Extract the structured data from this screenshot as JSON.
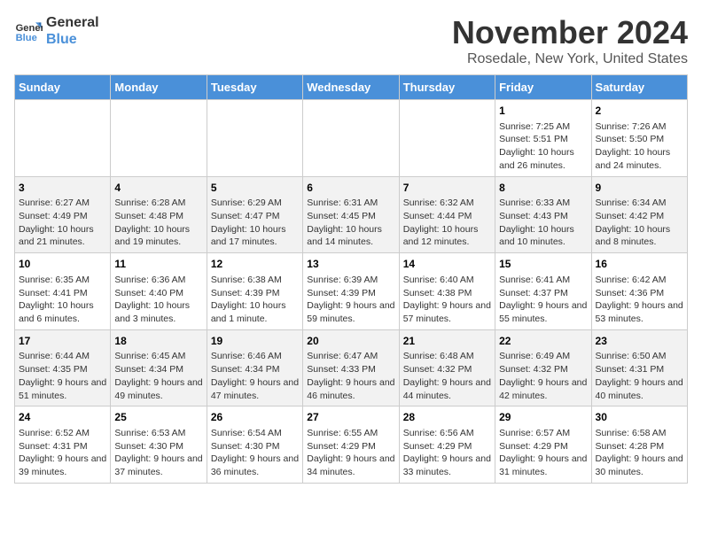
{
  "header": {
    "logo_general": "General",
    "logo_blue": "Blue",
    "month": "November 2024",
    "location": "Rosedale, New York, United States"
  },
  "weekdays": [
    "Sunday",
    "Monday",
    "Tuesday",
    "Wednesday",
    "Thursday",
    "Friday",
    "Saturday"
  ],
  "weeks": [
    [
      {
        "day": "",
        "info": ""
      },
      {
        "day": "",
        "info": ""
      },
      {
        "day": "",
        "info": ""
      },
      {
        "day": "",
        "info": ""
      },
      {
        "day": "",
        "info": ""
      },
      {
        "day": "1",
        "info": "Sunrise: 7:25 AM\nSunset: 5:51 PM\nDaylight: 10 hours and 26 minutes."
      },
      {
        "day": "2",
        "info": "Sunrise: 7:26 AM\nSunset: 5:50 PM\nDaylight: 10 hours and 24 minutes."
      }
    ],
    [
      {
        "day": "3",
        "info": "Sunrise: 6:27 AM\nSunset: 4:49 PM\nDaylight: 10 hours and 21 minutes."
      },
      {
        "day": "4",
        "info": "Sunrise: 6:28 AM\nSunset: 4:48 PM\nDaylight: 10 hours and 19 minutes."
      },
      {
        "day": "5",
        "info": "Sunrise: 6:29 AM\nSunset: 4:47 PM\nDaylight: 10 hours and 17 minutes."
      },
      {
        "day": "6",
        "info": "Sunrise: 6:31 AM\nSunset: 4:45 PM\nDaylight: 10 hours and 14 minutes."
      },
      {
        "day": "7",
        "info": "Sunrise: 6:32 AM\nSunset: 4:44 PM\nDaylight: 10 hours and 12 minutes."
      },
      {
        "day": "8",
        "info": "Sunrise: 6:33 AM\nSunset: 4:43 PM\nDaylight: 10 hours and 10 minutes."
      },
      {
        "day": "9",
        "info": "Sunrise: 6:34 AM\nSunset: 4:42 PM\nDaylight: 10 hours and 8 minutes."
      }
    ],
    [
      {
        "day": "10",
        "info": "Sunrise: 6:35 AM\nSunset: 4:41 PM\nDaylight: 10 hours and 6 minutes."
      },
      {
        "day": "11",
        "info": "Sunrise: 6:36 AM\nSunset: 4:40 PM\nDaylight: 10 hours and 3 minutes."
      },
      {
        "day": "12",
        "info": "Sunrise: 6:38 AM\nSunset: 4:39 PM\nDaylight: 10 hours and 1 minute."
      },
      {
        "day": "13",
        "info": "Sunrise: 6:39 AM\nSunset: 4:39 PM\nDaylight: 9 hours and 59 minutes."
      },
      {
        "day": "14",
        "info": "Sunrise: 6:40 AM\nSunset: 4:38 PM\nDaylight: 9 hours and 57 minutes."
      },
      {
        "day": "15",
        "info": "Sunrise: 6:41 AM\nSunset: 4:37 PM\nDaylight: 9 hours and 55 minutes."
      },
      {
        "day": "16",
        "info": "Sunrise: 6:42 AM\nSunset: 4:36 PM\nDaylight: 9 hours and 53 minutes."
      }
    ],
    [
      {
        "day": "17",
        "info": "Sunrise: 6:44 AM\nSunset: 4:35 PM\nDaylight: 9 hours and 51 minutes."
      },
      {
        "day": "18",
        "info": "Sunrise: 6:45 AM\nSunset: 4:34 PM\nDaylight: 9 hours and 49 minutes."
      },
      {
        "day": "19",
        "info": "Sunrise: 6:46 AM\nSunset: 4:34 PM\nDaylight: 9 hours and 47 minutes."
      },
      {
        "day": "20",
        "info": "Sunrise: 6:47 AM\nSunset: 4:33 PM\nDaylight: 9 hours and 46 minutes."
      },
      {
        "day": "21",
        "info": "Sunrise: 6:48 AM\nSunset: 4:32 PM\nDaylight: 9 hours and 44 minutes."
      },
      {
        "day": "22",
        "info": "Sunrise: 6:49 AM\nSunset: 4:32 PM\nDaylight: 9 hours and 42 minutes."
      },
      {
        "day": "23",
        "info": "Sunrise: 6:50 AM\nSunset: 4:31 PM\nDaylight: 9 hours and 40 minutes."
      }
    ],
    [
      {
        "day": "24",
        "info": "Sunrise: 6:52 AM\nSunset: 4:31 PM\nDaylight: 9 hours and 39 minutes."
      },
      {
        "day": "25",
        "info": "Sunrise: 6:53 AM\nSunset: 4:30 PM\nDaylight: 9 hours and 37 minutes."
      },
      {
        "day": "26",
        "info": "Sunrise: 6:54 AM\nSunset: 4:30 PM\nDaylight: 9 hours and 36 minutes."
      },
      {
        "day": "27",
        "info": "Sunrise: 6:55 AM\nSunset: 4:29 PM\nDaylight: 9 hours and 34 minutes."
      },
      {
        "day": "28",
        "info": "Sunrise: 6:56 AM\nSunset: 4:29 PM\nDaylight: 9 hours and 33 minutes."
      },
      {
        "day": "29",
        "info": "Sunrise: 6:57 AM\nSunset: 4:29 PM\nDaylight: 9 hours and 31 minutes."
      },
      {
        "day": "30",
        "info": "Sunrise: 6:58 AM\nSunset: 4:28 PM\nDaylight: 9 hours and 30 minutes."
      }
    ]
  ]
}
